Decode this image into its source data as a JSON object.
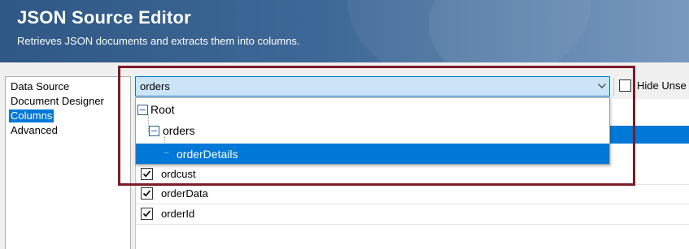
{
  "header": {
    "title": "JSON Source Editor",
    "subtitle": "Retrieves JSON documents and extracts them into columns."
  },
  "nav": {
    "items": [
      {
        "label": "Data Source",
        "selected": false
      },
      {
        "label": "Document Designer",
        "selected": false
      },
      {
        "label": "Columns",
        "selected": true
      },
      {
        "label": "Advanced",
        "selected": false
      }
    ]
  },
  "path_combo": {
    "value": "orders",
    "expanded": true
  },
  "hide_unused": {
    "label": "Hide Unse",
    "checked": false
  },
  "tree": {
    "nodes": [
      {
        "label": "Root",
        "level": 0,
        "expanded": true
      },
      {
        "label": "orders",
        "level": 1,
        "expanded": true
      },
      {
        "label": "orderDetails",
        "level": 2,
        "selected": true
      }
    ]
  },
  "columns": [
    {
      "name": "ordcust",
      "checked": true
    },
    {
      "name": "orderData",
      "checked": true
    },
    {
      "name": "orderId",
      "checked": true
    }
  ],
  "colors": {
    "accent": "#0078d7",
    "annotation": "#7b1c27",
    "header": "#3d6796"
  }
}
